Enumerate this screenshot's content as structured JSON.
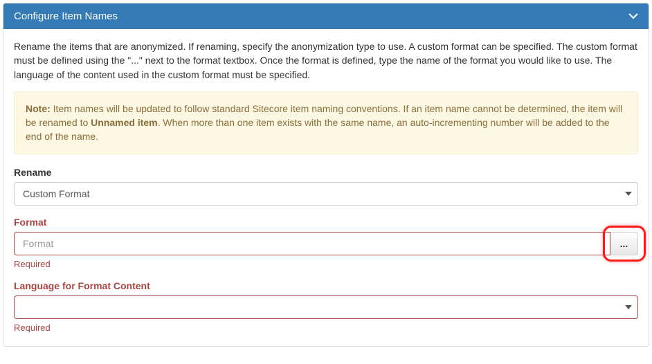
{
  "panel": {
    "title": "Configure Item Names",
    "intro": "Rename the items that are anonymized. If renaming, specify the anonymization type to use. A custom format can be specified. The custom format must be defined using the \"...\" next to the format textbox. Once the format is defined, type the name of the format you would like to use. The language of the content used in the custom format must be specified.",
    "note": {
      "label": "Note:",
      "text_before": " Item names will be updated to follow standard Sitecore item naming conventions. If an item name cannot be determined, the item will be renamed to ",
      "bold_item": "Unnamed item",
      "text_after": ". When more than one item exists with the same name, an auto-incrementing number will be added to the end of the name."
    }
  },
  "rename": {
    "label": "Rename",
    "selected": "Custom Format"
  },
  "format": {
    "label": "Format",
    "placeholder": "Format",
    "value": "",
    "button": "...",
    "required": "Required"
  },
  "language": {
    "label": "Language for Format Content",
    "selected": "",
    "required": "Required"
  }
}
